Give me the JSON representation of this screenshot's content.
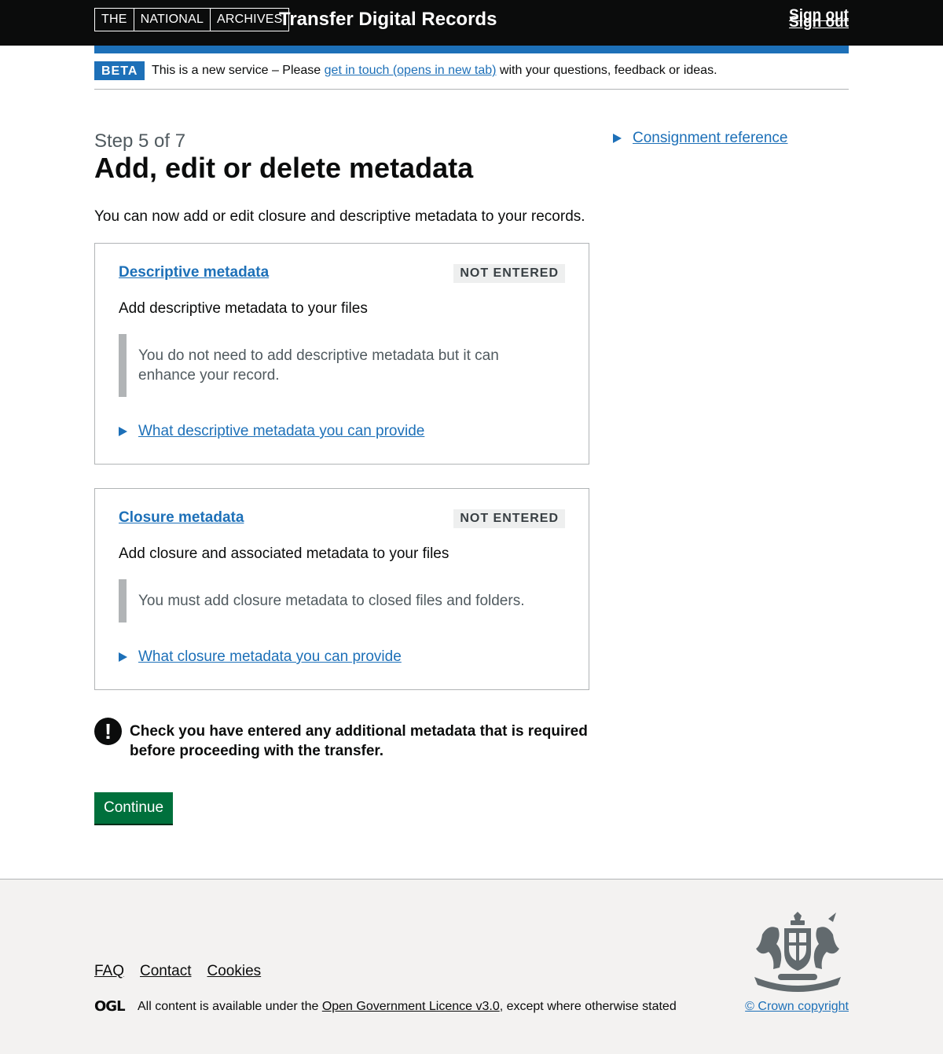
{
  "header": {
    "logo_parts": [
      "THE",
      "NATIONAL",
      "ARCHIVES"
    ],
    "service_name": "Transfer Digital Records",
    "sign_out": "Sign out"
  },
  "phase_banner": {
    "tag": "BETA",
    "text_before": "This is a new service – Please ",
    "link": "get in touch (opens in new tab)",
    "text_after": " with your questions, feedback or ideas."
  },
  "main": {
    "caption": "Step 5 of 7",
    "title": "Add, edit or delete metadata",
    "intro": "You can now add or edit closure and descriptive metadata to your records.",
    "cards": [
      {
        "title": "Descriptive metadata",
        "status": "NOT ENTERED",
        "description": "Add descriptive metadata to your files",
        "inset": "You do not need to add descriptive metadata but it can enhance your record.",
        "details": "What descriptive metadata you can provide"
      },
      {
        "title": "Closure metadata",
        "status": "NOT ENTERED",
        "description": "Add closure and associated metadata to your files",
        "inset": "You must add closure metadata to closed files and folders.",
        "details": "What closure metadata you can provide"
      }
    ],
    "warning_icon": "!",
    "warning": "Check you have entered any additional metadata that is required before proceeding with the transfer.",
    "continue": "Continue"
  },
  "sidebar": {
    "details": "Consignment reference"
  },
  "footer": {
    "links": [
      "FAQ",
      "Contact",
      "Cookies"
    ],
    "ogl_logo": "OGL",
    "licence_before": "All content is available under the ",
    "licence_link": "Open Government Licence v3.0",
    "licence_after": ", except where otherwise stated",
    "copyright": "© Crown copyright"
  },
  "colors": {
    "header_bg": "#0b0c0c",
    "link": "#1d70b8",
    "button": "#00703c",
    "footer_bg": "#f3f2f1"
  }
}
